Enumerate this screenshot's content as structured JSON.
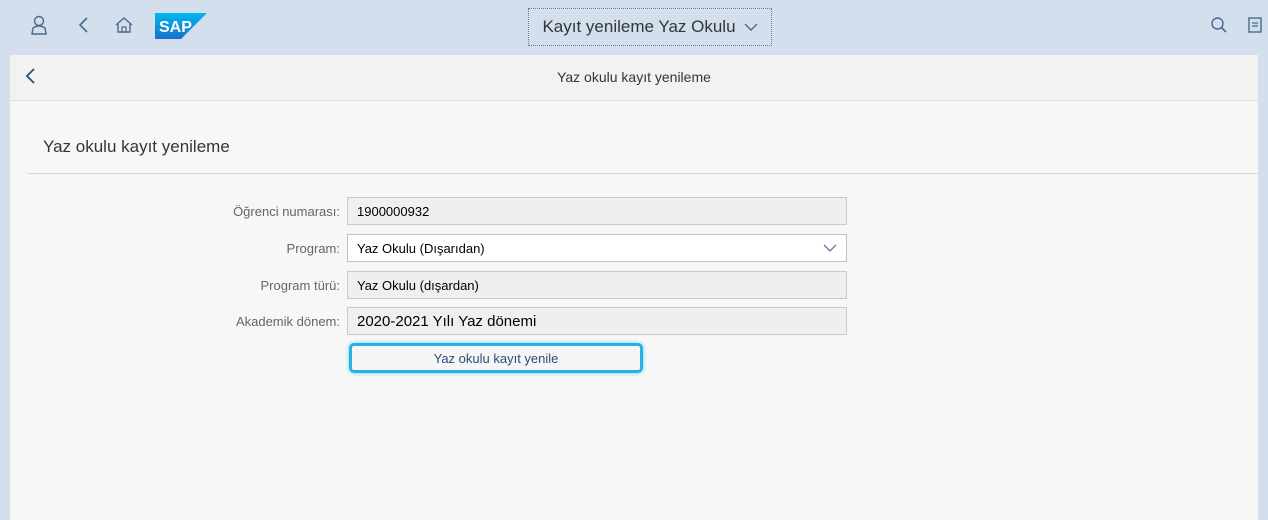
{
  "shell": {
    "title": "Kayıt yenileme Yaz Okulu",
    "logo_text": "SAP"
  },
  "subheader": {
    "title": "Yaz okulu kayıt yenileme"
  },
  "page": {
    "title": "Yaz okulu kayıt yenileme"
  },
  "form": {
    "student_number": {
      "label": "Öğrenci numarası:",
      "value": "1900000932"
    },
    "program": {
      "label": "Program:",
      "value": "Yaz Okulu (Dışarıdan)"
    },
    "program_type": {
      "label": "Program türü:",
      "value": "Yaz Okulu (dışardan)"
    },
    "academic_term": {
      "label": "Akademik dönem:",
      "value": "2020-2021 Yılı Yaz dönemi"
    },
    "submit_label": "Yaz okulu kayıt yenile"
  },
  "colors": {
    "shell_bg": "#d3dfec",
    "accent": "#29b0e4",
    "sap_blue": "#1a7fd1"
  }
}
